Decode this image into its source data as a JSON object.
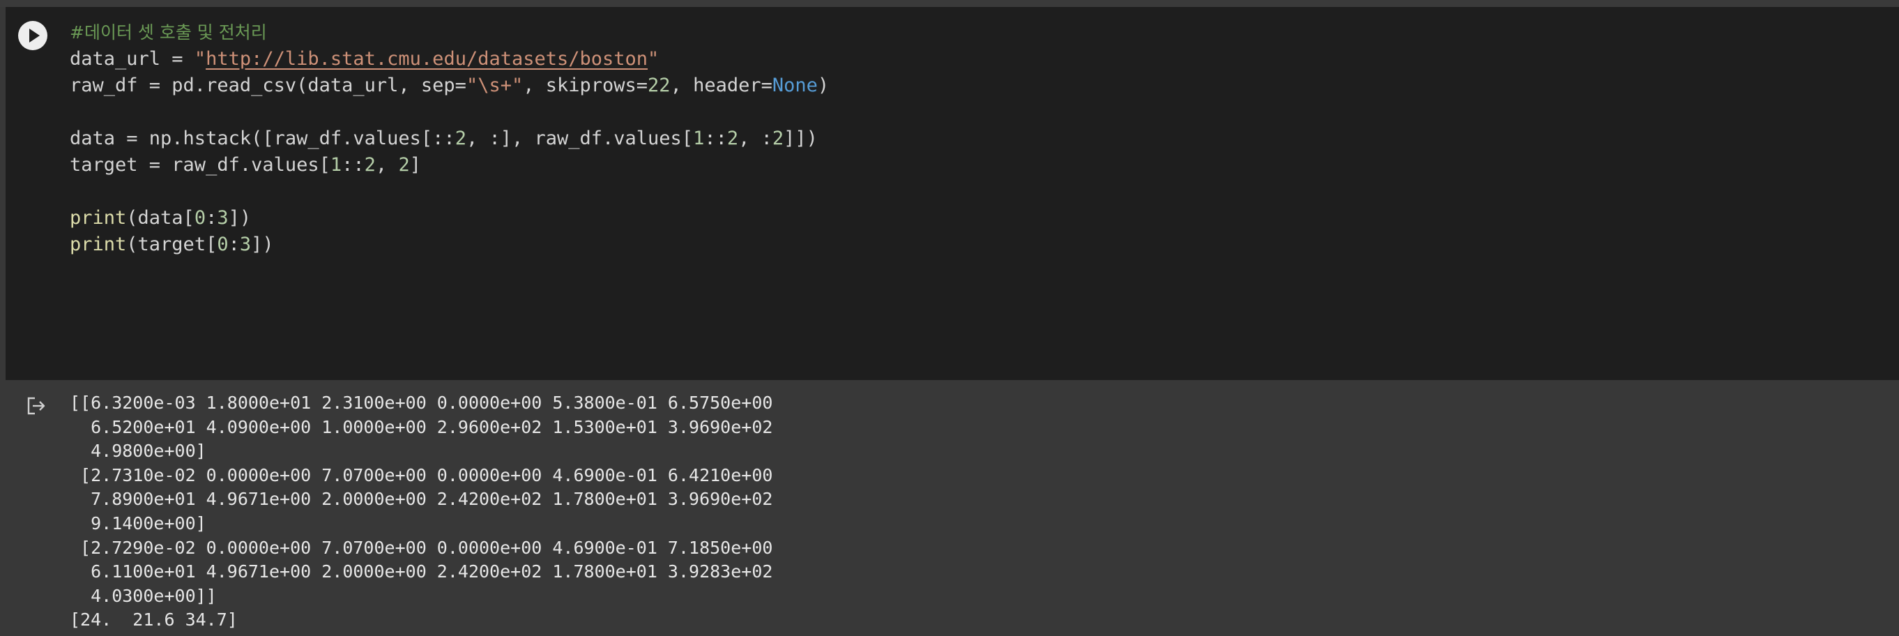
{
  "cell": {
    "code_lines": [
      [
        {
          "t": "#데이터 셋 호출 및 전처리",
          "c": "c-comment"
        }
      ],
      [
        {
          "t": "data_url = "
        },
        {
          "t": "\"",
          "c": "c-str"
        },
        {
          "t": "http://lib.stat.cmu.edu/datasets/boston",
          "c": "c-link"
        },
        {
          "t": "\"",
          "c": "c-str"
        }
      ],
      [
        {
          "t": "raw_df = pd.read_csv(data_url, sep="
        },
        {
          "t": "\"\\s+\"",
          "c": "c-str"
        },
        {
          "t": ", skiprows="
        },
        {
          "t": "22",
          "c": "c-num"
        },
        {
          "t": ", header="
        },
        {
          "t": "None",
          "c": "c-kw"
        },
        {
          "t": ")"
        }
      ],
      [],
      [
        {
          "t": "data = np.hstack([raw_df.values[::"
        },
        {
          "t": "2",
          "c": "c-num"
        },
        {
          "t": ", :], raw_df.values["
        },
        {
          "t": "1",
          "c": "c-num"
        },
        {
          "t": "::"
        },
        {
          "t": "2",
          "c": "c-num"
        },
        {
          "t": ", :"
        },
        {
          "t": "2",
          "c": "c-num"
        },
        {
          "t": "]])"
        }
      ],
      [
        {
          "t": "target = raw_df.values["
        },
        {
          "t": "1",
          "c": "c-num"
        },
        {
          "t": "::"
        },
        {
          "t": "2",
          "c": "c-num"
        },
        {
          "t": ", "
        },
        {
          "t": "2",
          "c": "c-num"
        },
        {
          "t": "]"
        }
      ],
      [],
      [
        {
          "t": "print",
          "c": "c-fn"
        },
        {
          "t": "(data["
        },
        {
          "t": "0",
          "c": "c-num"
        },
        {
          "t": ":"
        },
        {
          "t": "3",
          "c": "c-num"
        },
        {
          "t": "])"
        }
      ],
      [
        {
          "t": "print",
          "c": "c-fn"
        },
        {
          "t": "(target["
        },
        {
          "t": "0",
          "c": "c-num"
        },
        {
          "t": ":"
        },
        {
          "t": "3",
          "c": "c-num"
        },
        {
          "t": "])"
        }
      ]
    ]
  },
  "output": {
    "lines": [
      "[[6.3200e-03 1.8000e+01 2.3100e+00 0.0000e+00 5.3800e-01 6.5750e+00",
      "  6.5200e+01 4.0900e+00 1.0000e+00 2.9600e+02 1.5300e+01 3.9690e+02",
      "  4.9800e+00]",
      " [2.7310e-02 0.0000e+00 7.0700e+00 0.0000e+00 4.6900e-01 6.4210e+00",
      "  7.8900e+01 4.9671e+00 2.0000e+00 2.4200e+02 1.7800e+01 3.9690e+02",
      "  9.1400e+00]",
      " [2.7290e-02 0.0000e+00 7.0700e+00 0.0000e+00 4.6900e-01 7.1850e+00",
      "  6.1100e+01 4.9671e+00 2.0000e+00 2.4200e+02 1.7800e+01 3.9283e+02",
      "  4.0300e+00]]",
      "[24.  21.6 34.7]"
    ]
  },
  "icons": {
    "run": "play-circle-icon",
    "output": "output-redirect-icon"
  },
  "colors": {
    "cell_background": "#1e1e1e",
    "output_background": "#383838",
    "comment": "#6a9955",
    "string": "#ce9178",
    "number": "#b5cea8",
    "keyword": "#569cd6",
    "function": "#dcdcaa"
  }
}
